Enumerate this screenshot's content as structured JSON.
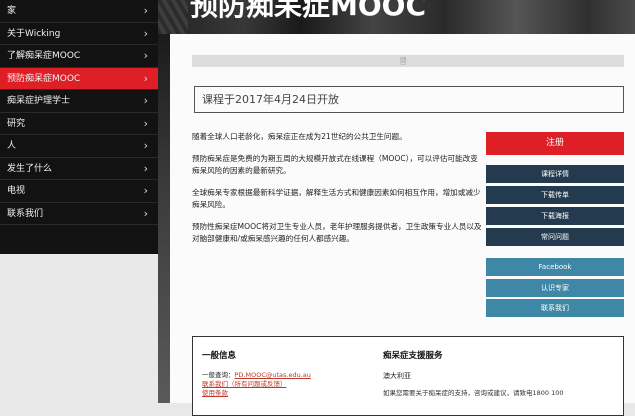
{
  "sidebar": {
    "items": [
      {
        "label": "家"
      },
      {
        "label": "关于Wicking"
      },
      {
        "label": "了解痴呆症MOOC"
      },
      {
        "label": "预防痴呆症MOOC"
      },
      {
        "label": "痴呆症护理学士"
      },
      {
        "label": "研究"
      },
      {
        "label": "人"
      },
      {
        "label": "发生了什么"
      },
      {
        "label": "电视"
      },
      {
        "label": "联系我们"
      }
    ],
    "chevron": "›",
    "active_color": "#de1f26"
  },
  "hero": {
    "title": "预防痴呆症MOOC"
  },
  "image_placeholder": {
    "icon": "image-icon",
    "glyph": "🖹"
  },
  "course_date": "课程于2017年4月24日开放",
  "paragraphs": [
    "随着全球人口老龄化，痴呆症正在成为21世纪的公共卫生问题。",
    "预防痴呆症是免费的为期五周的大规模开放式在线课程（MOOC），可以评估可能改变痴呆风险的因素的最新研究。",
    "全球痴呆专家根据最新科学证据，解释生活方式和健康因素如何相互作用，增加或减少痴呆风险。",
    "预防性痴呆症MOOC将对卫生专业人员，老年护理服务提供者，卫生政策专业人员以及对脑部健康和/或痴呆感兴趣的任何人都感兴趣。"
  ],
  "actions": {
    "register": "注册",
    "details": "课程详情",
    "download_flyer": "下载传单",
    "download_poster": "下载海报",
    "faq": "常问问题"
  },
  "social": {
    "facebook": "Facebook",
    "recognize_expert": "认识专家",
    "contact_us": "联系我们"
  },
  "general_info": {
    "heading": "一般信息",
    "enquiry_prefix": "一般查询：",
    "enquiry_email": "PD.MOOC@utas.edu.au",
    "feedback_link": "联系我们（所有问题或反馈）",
    "terms_link": "使用条款"
  },
  "dementia_support": {
    "heading": "痴呆症支援服务",
    "country": "澳大利亚",
    "partial_text": "如果您需要关于痴呆症的支持，咨询或建议，请致电1800 100"
  },
  "colors": {
    "accent_red": "#de1f26",
    "navy": "#243a4e",
    "teal": "#3f87a6"
  }
}
